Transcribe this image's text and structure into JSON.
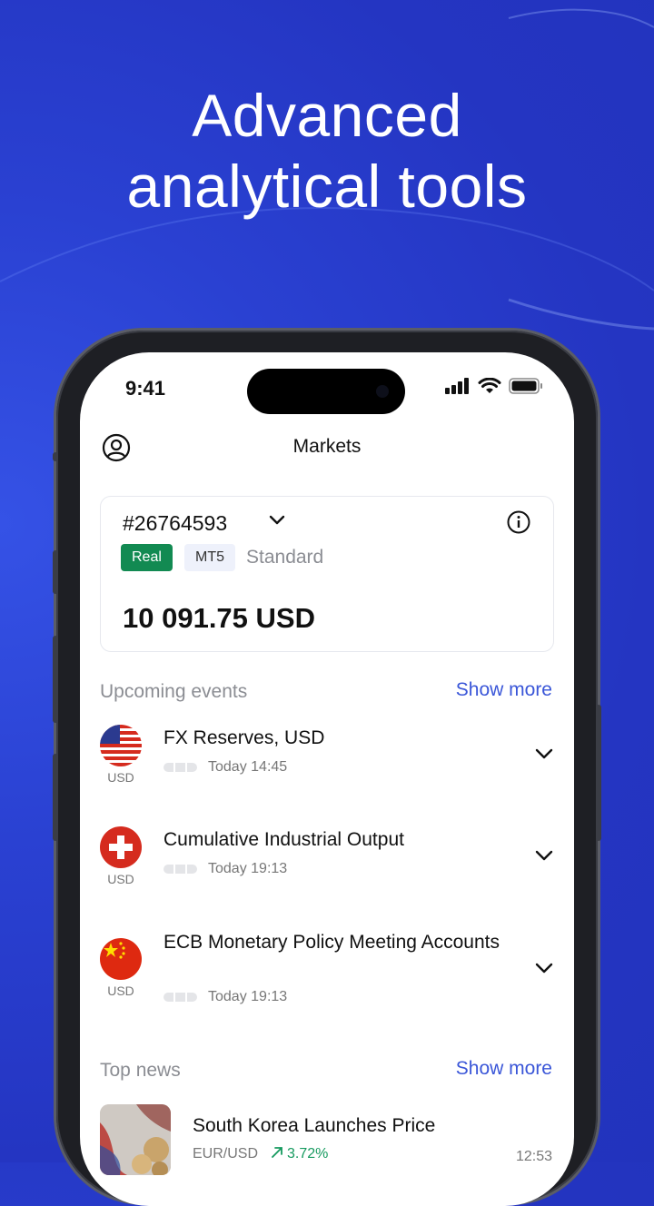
{
  "promo": {
    "headline_line1": "Advanced",
    "headline_line2": "analytical tools"
  },
  "status_bar": {
    "time": "9:41"
  },
  "topbar": {
    "title": "Markets",
    "profile_icon": "user-circle-icon"
  },
  "account": {
    "number": "#26764593",
    "badge_type": "Real",
    "badge_platform": "MT5",
    "account_type": "Standard",
    "balance": "10 091.75 USD"
  },
  "events_section": {
    "title": "Upcoming events",
    "show_more": "Show more",
    "items": [
      {
        "flag": "us-flag-icon",
        "currency": "USD",
        "title": "FX Reserves, USD",
        "time": "Today 14:45"
      },
      {
        "flag": "swiss-flag-icon",
        "currency": "USD",
        "title": "Cumulative Industrial Output",
        "time": "Today 19:13"
      },
      {
        "flag": "china-flag-icon",
        "currency": "USD",
        "title": "ECB Monetary Policy Meeting Accounts",
        "time": "Today 19:13"
      }
    ]
  },
  "news_section": {
    "title": "Top news",
    "show_more": "Show more",
    "items": [
      {
        "title": "South Korea Launches Price",
        "pair": "EUR/USD",
        "change": "3.72%",
        "time": "12:53"
      }
    ]
  },
  "colors": {
    "brand_blue": "#2a41d2",
    "link": "#3a56d8",
    "real_badge": "#128a52",
    "positive": "#169a5f"
  }
}
